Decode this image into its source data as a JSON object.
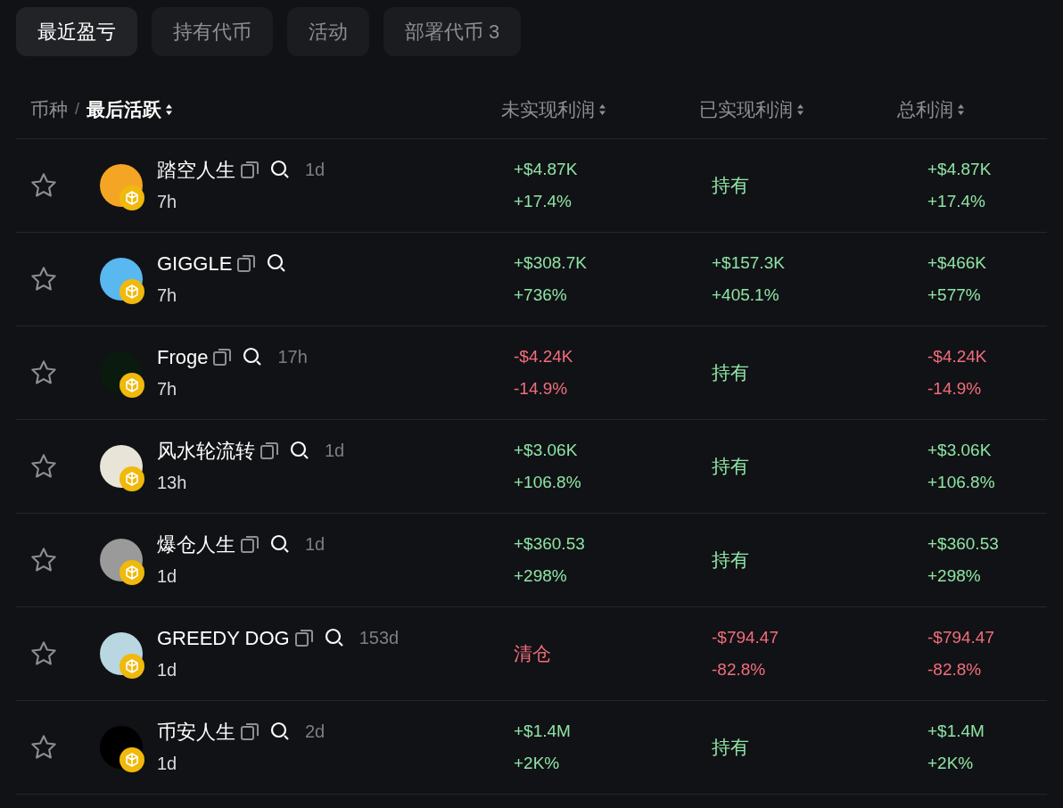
{
  "tabs": [
    {
      "label": "最近盈亏",
      "selected": true
    },
    {
      "label": "持有代币",
      "selected": false
    },
    {
      "label": "活动",
      "selected": false
    },
    {
      "label": "部署代币 3",
      "selected": false
    }
  ],
  "table": {
    "columns": [
      {
        "label": "币种",
        "separator": "/",
        "sub_label": "最后活跃"
      },
      {
        "label": "未实现利润"
      },
      {
        "label": "已实现利润"
      },
      {
        "label": "总利润"
      }
    ],
    "rows": [
      {
        "name": "踏空人生",
        "age": "1d",
        "last_active": "7h",
        "color": "#f5a524",
        "unrealized": {
          "kind": "value",
          "negative": false,
          "amount": "+$4.87K",
          "percent": "+17.4%"
        },
        "realized": {
          "kind": "status",
          "negative": false,
          "label": "持有"
        },
        "total": {
          "kind": "value",
          "negative": false,
          "amount": "+$4.87K",
          "percent": "+17.4%"
        }
      },
      {
        "name": "GIGGLE",
        "last_active": "7h",
        "color": "#5ab8f0",
        "unrealized": {
          "kind": "value",
          "negative": false,
          "amount": "+$308.7K",
          "percent": "+736%"
        },
        "realized": {
          "kind": "value",
          "negative": false,
          "amount": "+$157.3K",
          "percent": "+405.1%"
        },
        "total": {
          "kind": "value",
          "negative": false,
          "amount": "+$466K",
          "percent": "+577%"
        }
      },
      {
        "name": "Froge",
        "age": "17h",
        "last_active": "7h",
        "color": "#0b1a0e",
        "unrealized": {
          "kind": "value",
          "negative": true,
          "amount": "-$4.24K",
          "percent": "-14.9%"
        },
        "realized": {
          "kind": "status",
          "negative": false,
          "label": "持有"
        },
        "total": {
          "kind": "value",
          "negative": true,
          "amount": "-$4.24K",
          "percent": "-14.9%"
        }
      },
      {
        "name": "风水轮流转",
        "age": "1d",
        "last_active": "13h",
        "color": "#e8e4d8",
        "unrealized": {
          "kind": "value",
          "negative": false,
          "amount": "+$3.06K",
          "percent": "+106.8%"
        },
        "realized": {
          "kind": "status",
          "negative": false,
          "label": "持有"
        },
        "total": {
          "kind": "value",
          "negative": false,
          "amount": "+$3.06K",
          "percent": "+106.8%"
        }
      },
      {
        "name": "爆仓人生",
        "age": "1d",
        "last_active": "1d",
        "color": "#9a9a9a",
        "unrealized": {
          "kind": "value",
          "negative": false,
          "amount": "+$360.53",
          "percent": "+298%"
        },
        "realized": {
          "kind": "status",
          "negative": false,
          "label": "持有"
        },
        "total": {
          "kind": "value",
          "negative": false,
          "amount": "+$360.53",
          "percent": "+298%"
        }
      },
      {
        "name": "GREEDY DOG",
        "age": "153d",
        "last_active": "1d",
        "color": "#b9d7e0",
        "unrealized": {
          "kind": "status",
          "negative": true,
          "label": "清仓"
        },
        "realized": {
          "kind": "value",
          "negative": true,
          "amount": "-$794.47",
          "percent": "-82.8%"
        },
        "total": {
          "kind": "value",
          "negative": true,
          "amount": "-$794.47",
          "percent": "-82.8%"
        }
      },
      {
        "name": "币安人生",
        "age": "2d",
        "last_active": "1d",
        "color": "#000000",
        "unrealized": {
          "kind": "value",
          "negative": false,
          "amount": "+$1.4M",
          "percent": "+2K%"
        },
        "realized": {
          "kind": "status",
          "negative": false,
          "label": "持有"
        },
        "total": {
          "kind": "value",
          "negative": false,
          "amount": "+$1.4M",
          "percent": "+2K%"
        }
      }
    ]
  }
}
